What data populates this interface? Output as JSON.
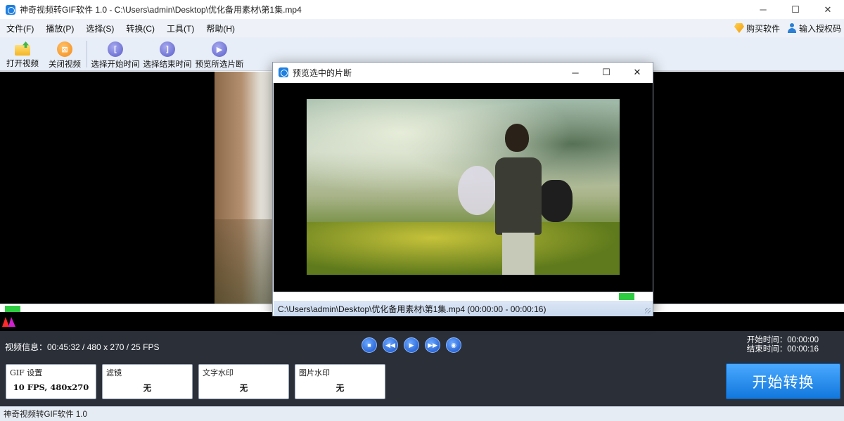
{
  "window": {
    "title": "神奇视频转GIF软件 1.0 - C:\\Users\\admin\\Desktop\\优化备用素材\\第1集.mp4",
    "controls": {
      "minimize": "─",
      "maximize": "☐",
      "close": "✕"
    }
  },
  "menu": {
    "items": [
      "文件(F)",
      "播放(P)",
      "选择(S)",
      "转换(C)",
      "工具(T)",
      "帮助(H)"
    ],
    "buy_label": "购买软件",
    "license_label": "输入授权码"
  },
  "toolbar": {
    "open_label": "打开视频",
    "close_label": "关闭视频",
    "start_label": "选择开始时间",
    "end_label": "选择结束时间",
    "preview_label": "预览所选片断"
  },
  "player": {
    "info": "视频信息：00:45:32 / 480 x 270 / 25 FPS",
    "start_time": "开始时间：00:00:00",
    "end_time": "结束时间：00:00:16",
    "progress": 0.02
  },
  "settings": {
    "gif": {
      "title": "GIF 设置",
      "value": "10 FPS, 480x270"
    },
    "filter": {
      "title": "滤镜",
      "value": "无"
    },
    "text_watermark": {
      "title": "文字水印",
      "value": "无"
    },
    "image_watermark": {
      "title": "图片水印",
      "value": "无"
    }
  },
  "convert_label": "开始转换",
  "status": "神奇视频转GIF软件 1.0",
  "preview_dialog": {
    "title": "预览选中的片断",
    "controls": {
      "minimize": "─",
      "maximize": "☐",
      "close": "✕"
    },
    "status": "C:\\Users\\admin\\Desktop\\优化备用素材\\第1集.mp4 (00:00:00 - 00:00:16)",
    "progress": 0.93
  },
  "colors": {
    "accent": "#1278dd",
    "progress": "#2ecc40",
    "panel": "#2a2f38"
  }
}
